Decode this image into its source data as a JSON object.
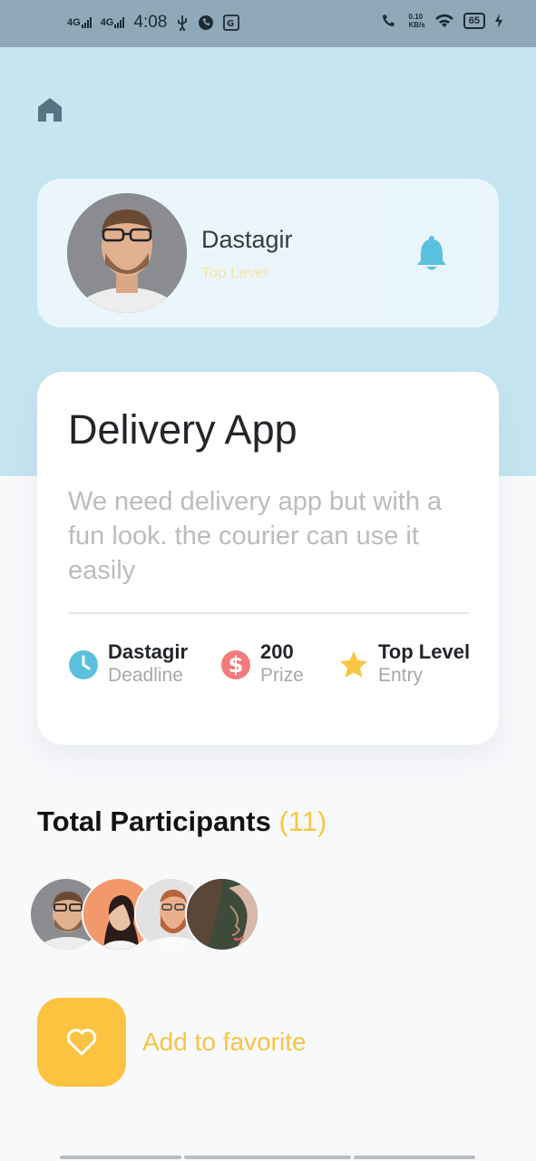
{
  "status_bar": {
    "network_1": "4G",
    "network_2": "4G",
    "time": "4:08",
    "net_speed_value": "0.10",
    "net_speed_unit": "KB/s",
    "battery": "65"
  },
  "profile": {
    "name": "Dastagir",
    "level": "Top Level"
  },
  "task": {
    "title": "Delivery App",
    "description": "We need delivery app but with a fun look.  the courier can use it easily",
    "meta": [
      {
        "value": "Dastagir",
        "label": "Deadline",
        "icon": "clock-icon",
        "color": "#5bc0de"
      },
      {
        "value": "200",
        "label": "Prize",
        "icon": "dollar-icon",
        "color": "#f37b7b"
      },
      {
        "value": "Top Level",
        "label": "Entry",
        "icon": "star-icon",
        "color": "#f7c744"
      }
    ]
  },
  "participants": {
    "title": "Total Participants",
    "count": "(11)"
  },
  "favorite": {
    "label": "Add to favorite"
  },
  "colors": {
    "hero": "#c5e5f1",
    "accent_yellow": "#fbc33f",
    "bell": "#5bc0de"
  }
}
